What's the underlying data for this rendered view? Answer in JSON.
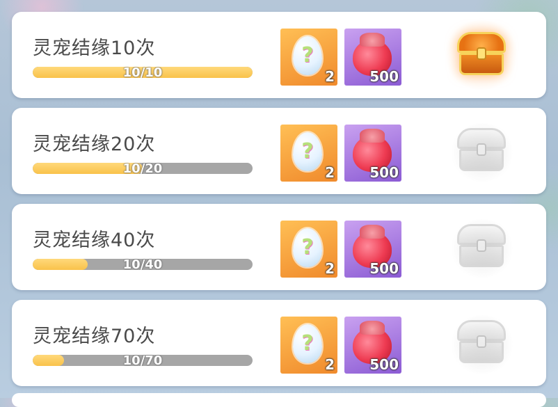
{
  "colors": {
    "progress_fill": "#f9c24a",
    "progress_track": "#a6a6a6",
    "item_orange": "#f08a2c",
    "item_purple": "#8b5bd4",
    "card_bg": "#ffffff",
    "title_text": "#4a4a4a"
  },
  "tasks": [
    {
      "title": "灵宠结缘10次",
      "progress_text": "10/10",
      "progress_fraction": 1.0,
      "rewards": [
        {
          "icon": "mystery-egg-icon",
          "quantity": "2"
        },
        {
          "icon": "red-pouch-icon",
          "quantity": "500"
        }
      ],
      "chest_state": "claimable",
      "chest_icon": "golden-chest-icon"
    },
    {
      "title": "灵宠结缘20次",
      "progress_text": "10/20",
      "progress_fraction": 0.5,
      "rewards": [
        {
          "icon": "mystery-egg-icon",
          "quantity": "2"
        },
        {
          "icon": "red-pouch-icon",
          "quantity": "500"
        }
      ],
      "chest_state": "locked",
      "chest_icon": "locked-chest-icon"
    },
    {
      "title": "灵宠结缘40次",
      "progress_text": "10/40",
      "progress_fraction": 0.25,
      "rewards": [
        {
          "icon": "mystery-egg-icon",
          "quantity": "2"
        },
        {
          "icon": "red-pouch-icon",
          "quantity": "500"
        }
      ],
      "chest_state": "locked",
      "chest_icon": "locked-chest-icon"
    },
    {
      "title": "灵宠结缘70次",
      "progress_text": "10/70",
      "progress_fraction": 0.1429,
      "rewards": [
        {
          "icon": "mystery-egg-icon",
          "quantity": "2"
        },
        {
          "icon": "red-pouch-icon",
          "quantity": "500"
        }
      ],
      "chest_state": "locked",
      "chest_icon": "locked-chest-icon"
    }
  ]
}
